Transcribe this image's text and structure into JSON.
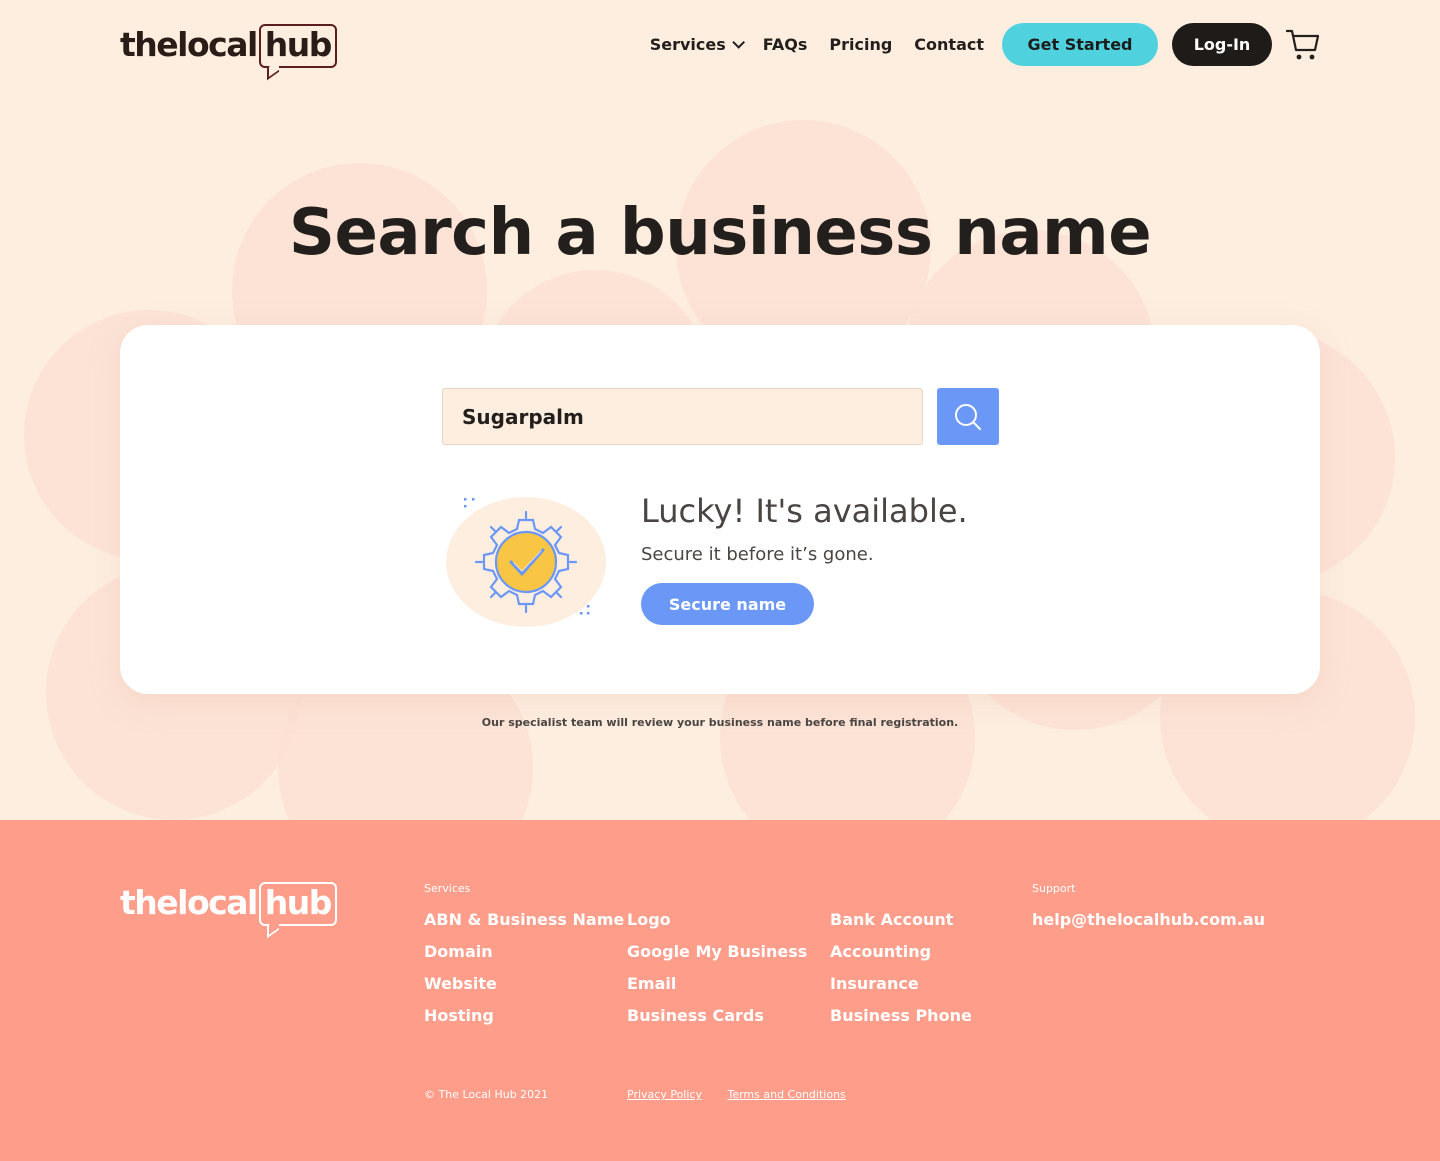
{
  "header": {
    "logo_main": "thelocal",
    "logo_hub": "hub",
    "nav": [
      {
        "label": "Services",
        "has_dropdown": true
      },
      {
        "label": "FAQs"
      },
      {
        "label": "Pricing"
      },
      {
        "label": "Contact"
      }
    ],
    "get_started_label": "Get Started",
    "login_label": "Log-In",
    "cart_icon": "shopping-cart-icon"
  },
  "hero": {
    "title": "Search a business name"
  },
  "search": {
    "value": "Sugarpalm",
    "button_icon": "search-icon"
  },
  "result": {
    "illustration_icon": "gear-check-icon",
    "title": "Lucky! It's available.",
    "subtitle": "Secure it before it’s gone.",
    "button_label": "Secure name"
  },
  "note": "Our specialist team will review your business name before final registration.",
  "footer": {
    "logo_main": "thelocal",
    "logo_hub": "hub",
    "services_heading": "Services",
    "columns": [
      [
        "ABN & Business Name",
        "Domain",
        "Website",
        "Hosting"
      ],
      [
        "Logo",
        "Google My Business",
        "Email",
        "Business Cards"
      ],
      [
        "Bank Account",
        "Accounting",
        "Insurance",
        "Business Phone"
      ]
    ],
    "support_heading": "Support",
    "support_email": "help@thelocalhub.com.au",
    "copyright": "© The Local Hub 2021",
    "privacy": "Privacy Policy",
    "terms": "Terms and Conditions"
  },
  "colors": {
    "background": "#fdeee0",
    "accent_teal": "#4fd2de",
    "accent_blue": "#6b97f7",
    "footer": "#fd9d8a",
    "dark": "#1f1b18"
  }
}
